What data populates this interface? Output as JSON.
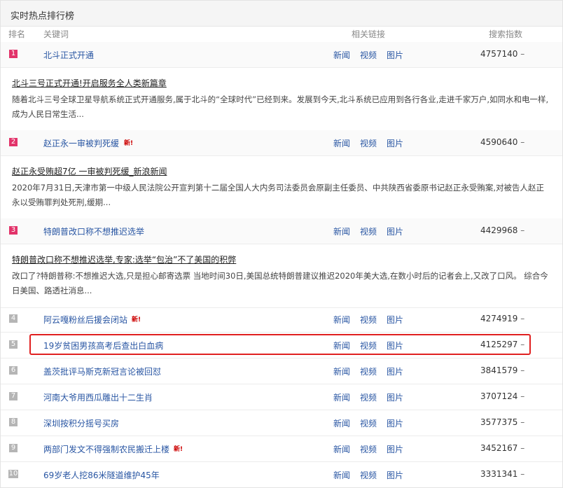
{
  "title": "实时热点排行榜",
  "columns": {
    "rank": "排名",
    "keyword": "关键词",
    "links": "相关链接",
    "index": "搜索指数"
  },
  "link_labels": {
    "news": "新闻",
    "video": "视频",
    "image": "图片"
  },
  "new_tag": "新!",
  "trend": "–",
  "items": [
    {
      "rank": "1",
      "keyword": "北斗正式开通",
      "index": "4757140",
      "detail_title": "北斗三号正式开通!开启服务全人类新篇章",
      "detail_body": "随着北斗三号全球卫星导航系统正式开通服务,属于北斗的“全球时代”已经到来。发展到今天,北斗系统已应用到各行各业,走进千家万户,如同水和电一样,成为人民日常生活..."
    },
    {
      "rank": "2",
      "keyword": "赵正永一审被判死缓",
      "index": "4590640",
      "detail_title": "赵正永受贿超7亿 一审被判死缓_新浪新闻",
      "detail_body": "2020年7月31日,天津市第一中级人民法院公开宣判第十二届全国人大内务司法委员会原副主任委员、中共陕西省委原书记赵正永受贿案,对被告人赵正永以受贿罪判处死刑,缓期..."
    },
    {
      "rank": "3",
      "keyword": "特朗普改口称不想推迟选举",
      "index": "4429968",
      "detail_title": "特朗普改口称不想推迟选举,专家:选举“包治”不了美国的积弊",
      "detail_body": "改口了?特朗普称:不想推迟大选,只是担心邮寄选票 当地时间30日,美国总统特朗普建议推迟2020年美大选,在数小时后的记者会上,又改了口风。 综合今日美国、路透社消息..."
    },
    {
      "rank": "4",
      "keyword": "阿云嘎粉丝后援会闭站",
      "index": "4274919"
    },
    {
      "rank": "5",
      "keyword": "19岁贫困男孩高考后查出白血病",
      "index": "4125297"
    },
    {
      "rank": "6",
      "keyword": "盖茨批评马斯克新冠言论被回怼",
      "index": "3841579"
    },
    {
      "rank": "7",
      "keyword": "河南大爷用西瓜雕出十二生肖",
      "index": "3707124"
    },
    {
      "rank": "8",
      "keyword": "深圳按积分摇号买房",
      "index": "3577375"
    },
    {
      "rank": "9",
      "keyword": "两部门发文不得强制农民搬迁上楼",
      "index": "3452167"
    },
    {
      "rank": "10",
      "keyword": "69岁老人挖86米隧道维护45年",
      "index": "3331341"
    }
  ]
}
